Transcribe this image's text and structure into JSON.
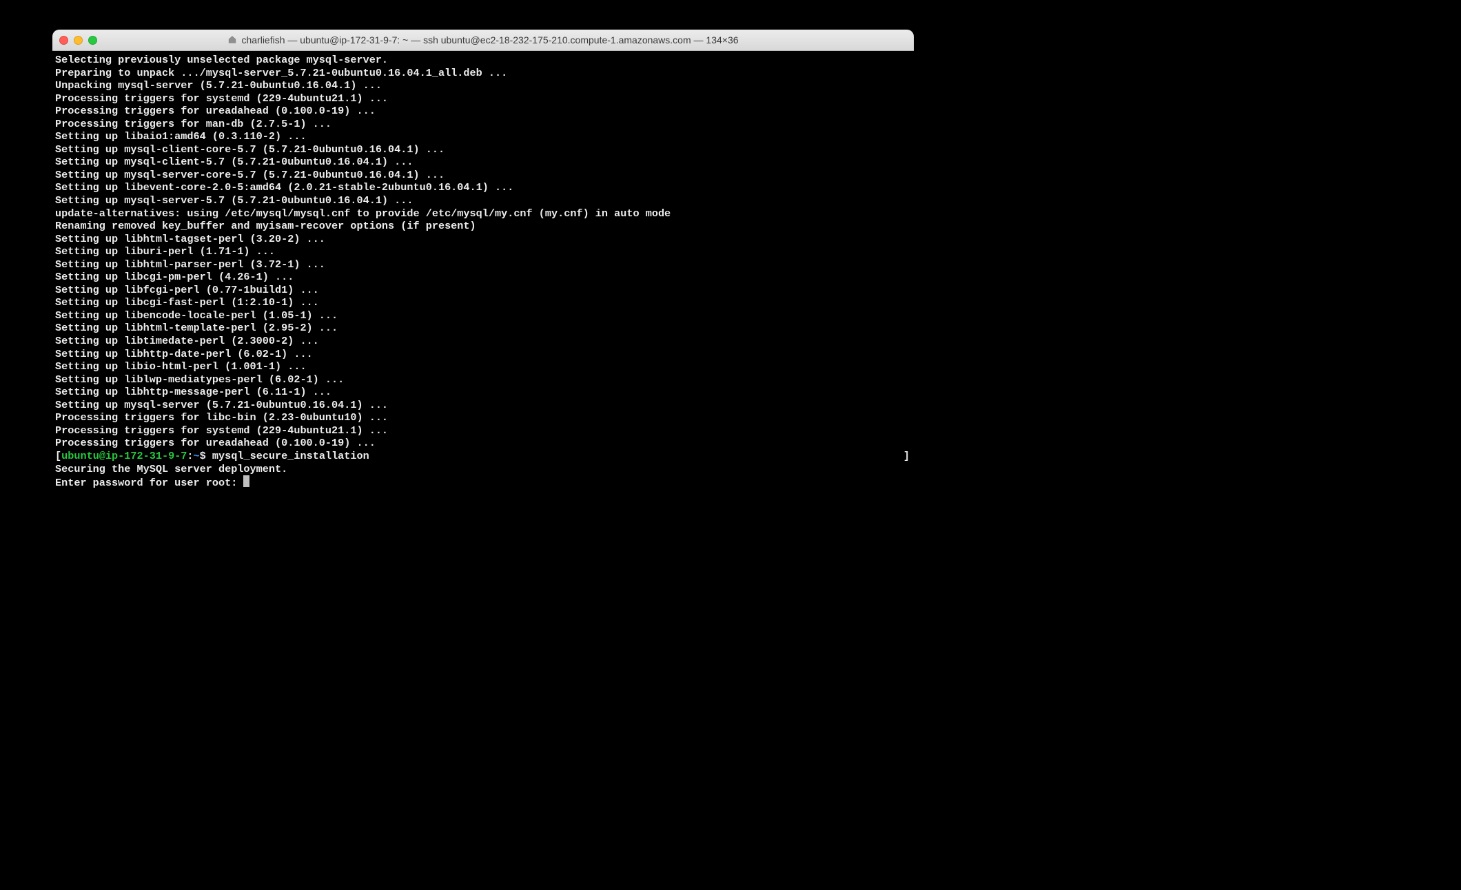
{
  "window": {
    "title": "charliefish — ubuntu@ip-172-31-9-7: ~ — ssh ubuntu@ec2-18-232-175-210.compute-1.amazonaws.com — 134×36"
  },
  "prompt": {
    "open_bracket": "[",
    "user": "ubuntu",
    "at": "@",
    "host": "ip-172-31-9-7",
    "colon": ":",
    "dir": "~",
    "dollar": "$ ",
    "command": "mysql_secure_installation",
    "right_bracket": "]"
  },
  "blank": "",
  "securing_line": "Securing the MySQL server deployment.",
  "password_prompt": "Enter password for user root: ",
  "output_lines": [
    "Selecting previously unselected package mysql-server.",
    "Preparing to unpack .../mysql-server_5.7.21-0ubuntu0.16.04.1_all.deb ...",
    "Unpacking mysql-server (5.7.21-0ubuntu0.16.04.1) ...",
    "Processing triggers for systemd (229-4ubuntu21.1) ...",
    "Processing triggers for ureadahead (0.100.0-19) ...",
    "Processing triggers for man-db (2.7.5-1) ...",
    "Setting up libaio1:amd64 (0.3.110-2) ...",
    "Setting up mysql-client-core-5.7 (5.7.21-0ubuntu0.16.04.1) ...",
    "Setting up mysql-client-5.7 (5.7.21-0ubuntu0.16.04.1) ...",
    "Setting up mysql-server-core-5.7 (5.7.21-0ubuntu0.16.04.1) ...",
    "Setting up libevent-core-2.0-5:amd64 (2.0.21-stable-2ubuntu0.16.04.1) ...",
    "Setting up mysql-server-5.7 (5.7.21-0ubuntu0.16.04.1) ...",
    "update-alternatives: using /etc/mysql/mysql.cnf to provide /etc/mysql/my.cnf (my.cnf) in auto mode",
    "Renaming removed key_buffer and myisam-recover options (if present)",
    "Setting up libhtml-tagset-perl (3.20-2) ...",
    "Setting up liburi-perl (1.71-1) ...",
    "Setting up libhtml-parser-perl (3.72-1) ...",
    "Setting up libcgi-pm-perl (4.26-1) ...",
    "Setting up libfcgi-perl (0.77-1build1) ...",
    "Setting up libcgi-fast-perl (1:2.10-1) ...",
    "Setting up libencode-locale-perl (1.05-1) ...",
    "Setting up libhtml-template-perl (2.95-2) ...",
    "Setting up libtimedate-perl (2.3000-2) ...",
    "Setting up libhttp-date-perl (6.02-1) ...",
    "Setting up libio-html-perl (1.001-1) ...",
    "Setting up liblwp-mediatypes-perl (6.02-1) ...",
    "Setting up libhttp-message-perl (6.11-1) ...",
    "Setting up mysql-server (5.7.21-0ubuntu0.16.04.1) ...",
    "Processing triggers for libc-bin (2.23-0ubuntu10) ...",
    "Processing triggers for systemd (229-4ubuntu21.1) ...",
    "Processing triggers for ureadahead (0.100.0-19) ..."
  ]
}
